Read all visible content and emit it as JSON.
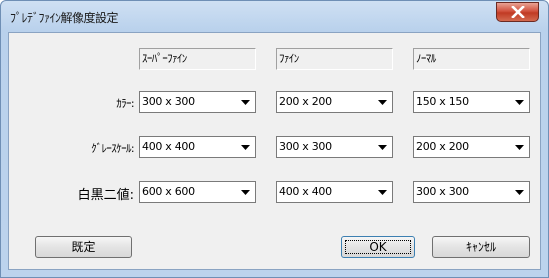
{
  "window": {
    "title": "ﾌﾟﾚﾃﾞﾌｧｲﾝ解像度設定"
  },
  "columns": [
    "ｽｰﾊﾟｰﾌｧｲﾝ",
    "ﾌｧｲﾝ",
    "ﾉｰﾏﾙ"
  ],
  "rows": [
    {
      "label": "ｶﾗｰ:",
      "values": [
        "300 x 300",
        "200 x 200",
        "150 x 150"
      ]
    },
    {
      "label": "ｸﾞﾚｰｽｹｰﾙ:",
      "values": [
        "400 x 400",
        "300 x 300",
        "200 x 200"
      ]
    },
    {
      "label": "白黒二値:",
      "values": [
        "600 x 600",
        "400 x 400",
        "300 x 300"
      ]
    }
  ],
  "buttons": {
    "default_label": "既定",
    "ok_label": "OK",
    "cancel_label": "ｷｬﾝｾﾙ"
  },
  "icons": {
    "close": "close-icon",
    "dropdown": "chevron-down-icon"
  },
  "colors": {
    "title_bar": "#bcd3ed",
    "close_button": "#c13a24",
    "client_bg": "#f0f0f0"
  }
}
